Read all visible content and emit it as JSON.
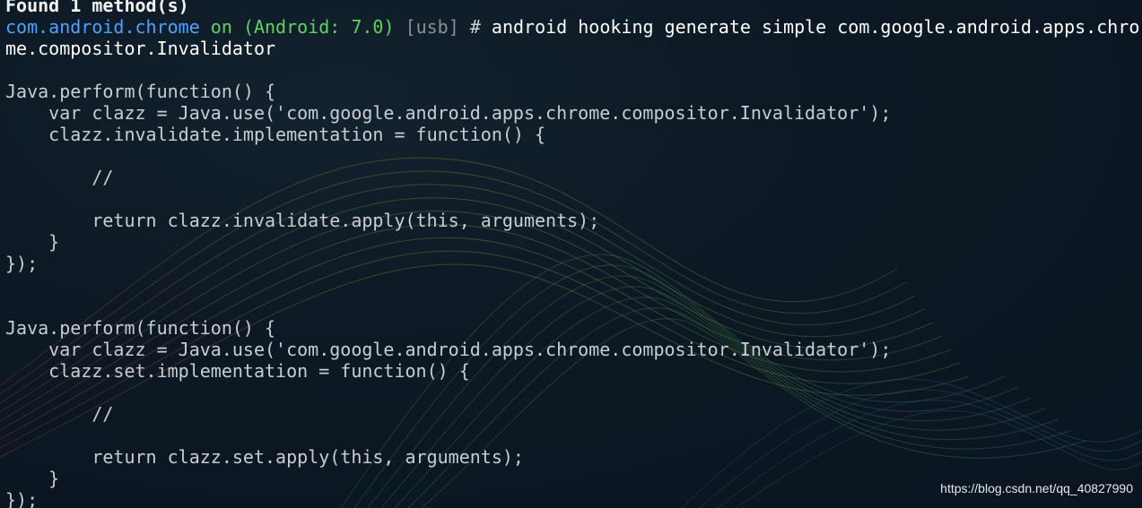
{
  "terminal": {
    "cut_line": "Found 1 method(s)",
    "prompt": {
      "host": "com.android.chrome",
      "on": "on",
      "device": "(Android: 7.0)",
      "connection": "[usb]",
      "hash": "#",
      "command_part1": "android hooking generate simple com.google.android.apps.chro",
      "command_part2": "me.compositor.Invalidator"
    },
    "code_lines": [
      "",
      "Java.perform(function() {",
      "    var clazz = Java.use('com.google.android.apps.chrome.compositor.Invalidator');",
      "    clazz.invalidate.implementation = function() {",
      "",
      "        //",
      "",
      "        return clazz.invalidate.apply(this, arguments);",
      "    }",
      "});",
      "",
      "",
      "Java.perform(function() {",
      "    var clazz = Java.use('com.google.android.apps.chrome.compositor.Invalidator');",
      "    clazz.set.implementation = function() {",
      "",
      "        //",
      "",
      "        return clazz.set.apply(this, arguments);",
      "    }",
      "});"
    ]
  },
  "watermark": "https://blog.csdn.net/qq_40827990",
  "colors": {
    "background": "#0c1823",
    "host": "#4aa3ff",
    "device": "#5fd35f",
    "connection": "#8a8f96",
    "code": "#c9ccd0"
  }
}
